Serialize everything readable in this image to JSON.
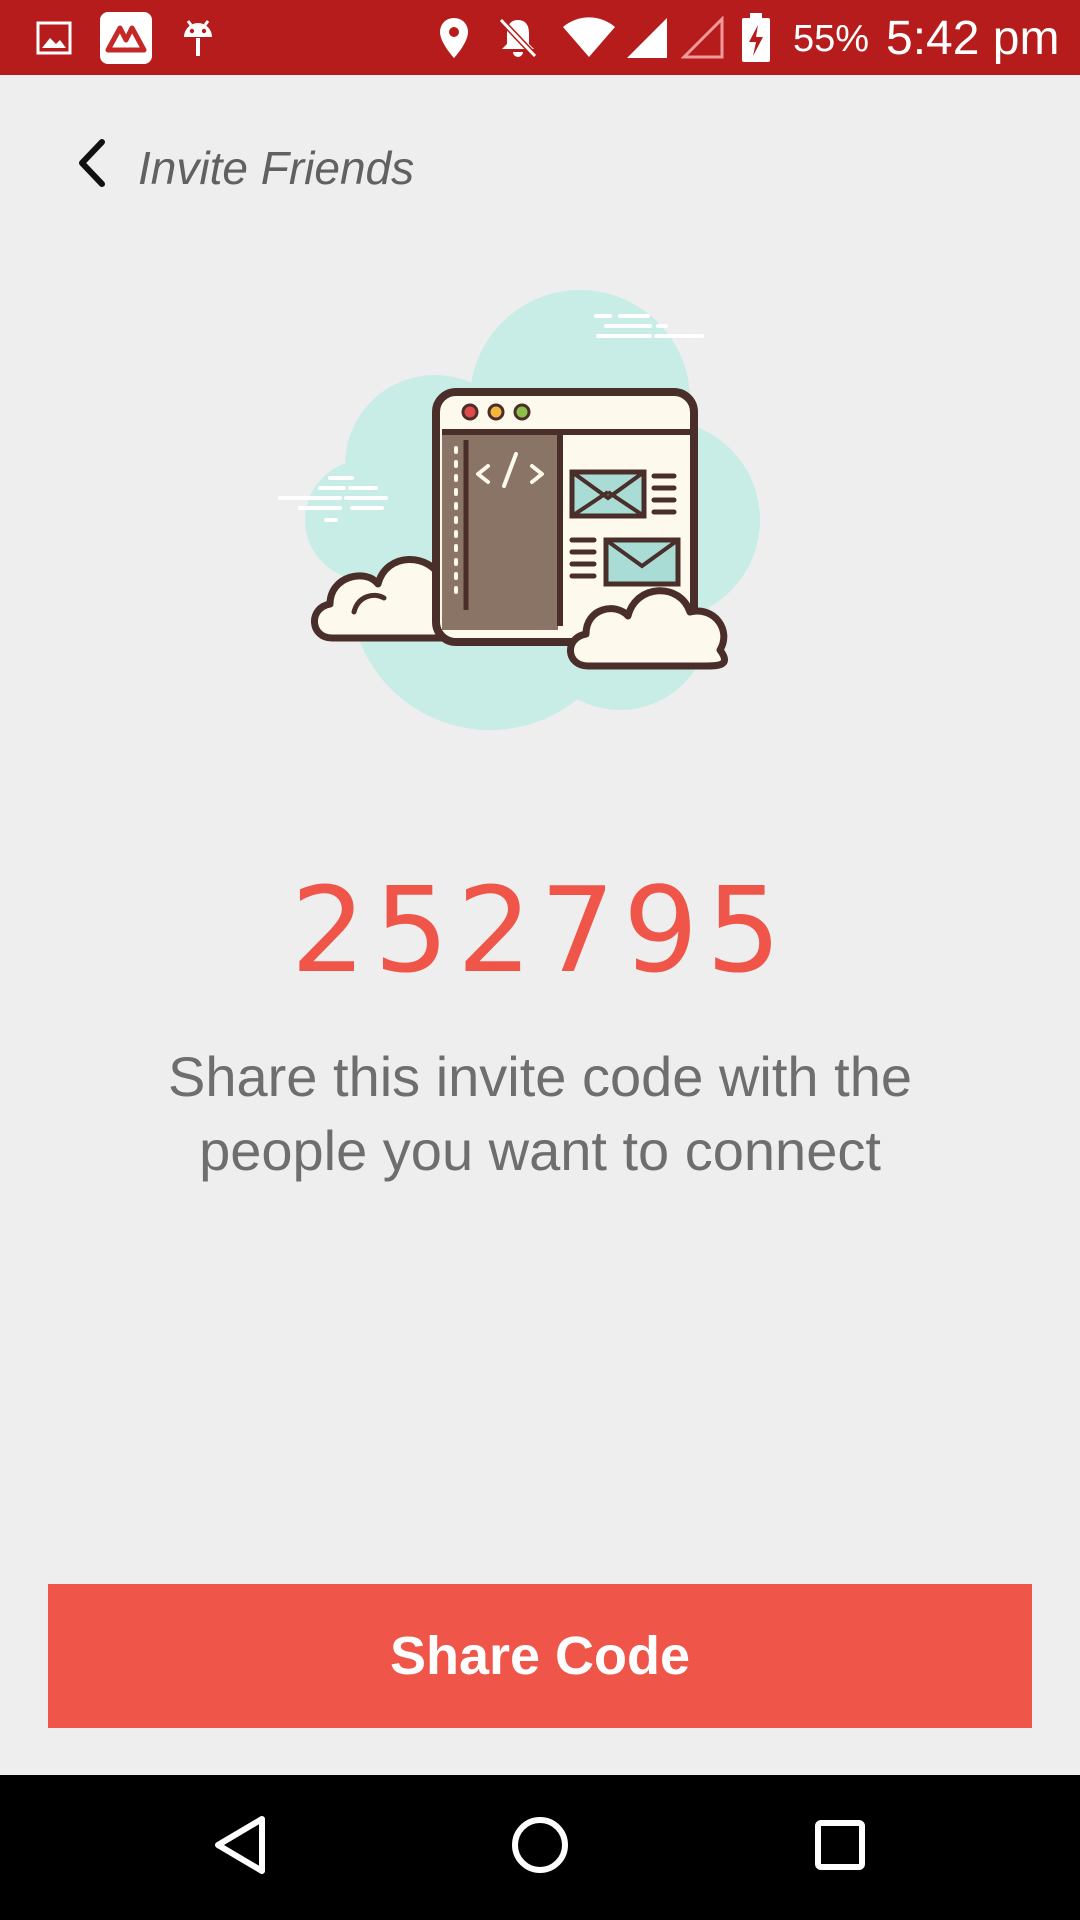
{
  "status_bar": {
    "battery_percent": "55%",
    "time": "5:42 pm",
    "icons": [
      "gallery-icon",
      "app-logo-icon",
      "android-debug-icon",
      "location-icon",
      "notifications-off-icon",
      "wifi-icon",
      "signal-icon",
      "signal-empty-icon",
      "battery-charging-icon"
    ]
  },
  "header": {
    "title": "Invite Friends",
    "back_icon": "chevron-left-icon"
  },
  "main": {
    "illustration": "browser-code-cloud-illustration",
    "invite_code": "252795",
    "description": "Share this invite code with the people you want to connect"
  },
  "actions": {
    "share_label": "Share Code"
  },
  "nav_bar": {
    "icons": [
      "back-triangle-icon",
      "home-circle-icon",
      "recents-square-icon"
    ]
  },
  "colors": {
    "status_bar": "#b71c1c",
    "accent": "#ef5548",
    "background": "#eeeeee",
    "text_secondary": "#6e6e6e"
  }
}
